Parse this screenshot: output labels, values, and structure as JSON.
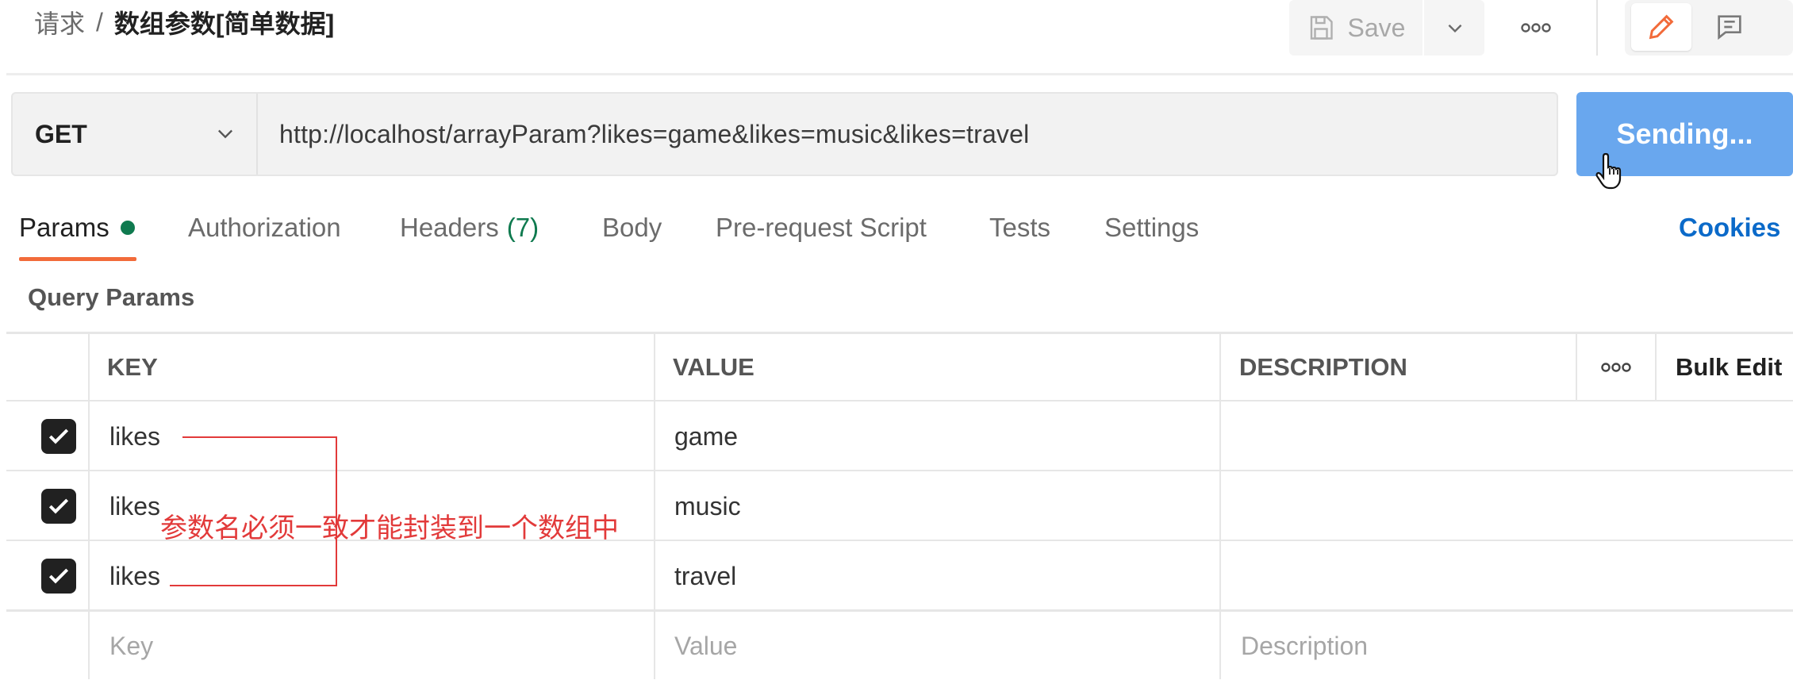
{
  "header": {
    "breadcrumb_parent": "请求",
    "breadcrumb_separator": "/",
    "breadcrumb_current": "数组参数[简单数据]",
    "save_label": "Save",
    "save_icon": "floppy-disk-icon",
    "more_icon": "ellipsis-icon",
    "edit_icon": "pencil-icon",
    "comment_icon": "comment-icon"
  },
  "request": {
    "method": "GET",
    "url": "http://localhost/arrayParam?likes=game&likes=music&likes=travel",
    "send_label": "Sending..."
  },
  "tabs": [
    {
      "label": "Params",
      "active": true,
      "indicator": "dot"
    },
    {
      "label": "Authorization"
    },
    {
      "label": "Headers",
      "count": "(7)"
    },
    {
      "label": "Body"
    },
    {
      "label": "Pre-request Script"
    },
    {
      "label": "Tests"
    },
    {
      "label": "Settings"
    }
  ],
  "cookies_label": "Cookies",
  "section_title": "Query Params",
  "table": {
    "headers": {
      "key": "KEY",
      "value": "VALUE",
      "description": "DESCRIPTION",
      "bulk_edit": "Bulk Edit"
    },
    "rows": [
      {
        "checked": true,
        "key": "likes",
        "value": "game",
        "description": ""
      },
      {
        "checked": true,
        "key": "likes",
        "value": "music",
        "description": ""
      },
      {
        "checked": true,
        "key": "likes",
        "value": "travel",
        "description": ""
      }
    ],
    "placeholders": {
      "key": "Key",
      "value": "Value",
      "description": "Description"
    }
  },
  "annotation": {
    "text": "参数名必须一致才能封装到一个数组中",
    "color": "#e23a3a"
  },
  "colors": {
    "accent_orange": "#f26b3a",
    "send_blue": "#69a7ee",
    "link_blue": "#0b6ac9",
    "status_green": "#0f7a4f"
  }
}
